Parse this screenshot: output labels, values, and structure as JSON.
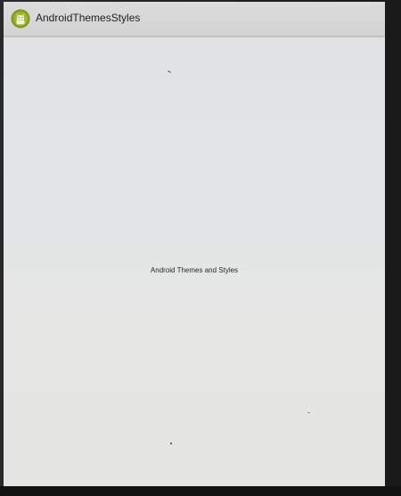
{
  "app": {
    "title": "AndroidThemesStyles",
    "icon": "android-app-icon"
  },
  "main": {
    "text": "Android Themes and Styles"
  },
  "colors": {
    "action_bar": "#d6d6d6",
    "background": "#e3e4e4",
    "icon_green": "#8fa624"
  }
}
